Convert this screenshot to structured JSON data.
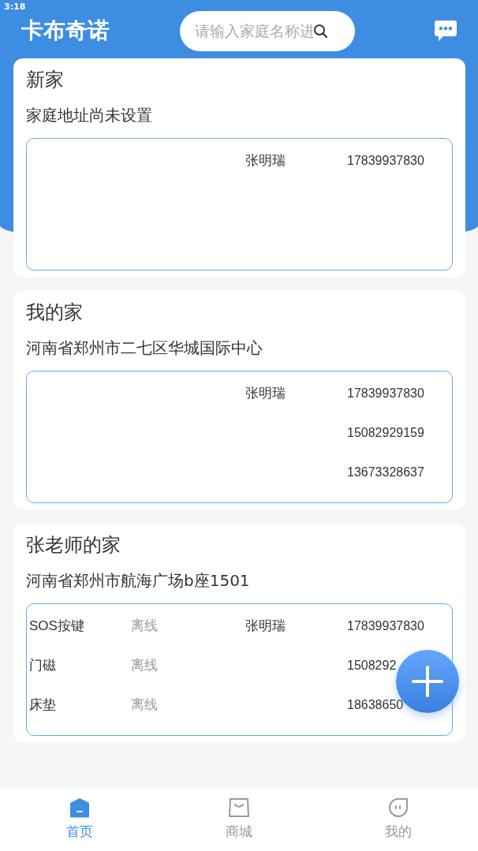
{
  "status_bar": {
    "time": "3:18"
  },
  "header": {
    "title": "卡布奇诺",
    "search": {
      "placeholder": "请输入家庭名称进"
    }
  },
  "homes": [
    {
      "name": "新家",
      "address": "家庭地址尚未设置",
      "rows": [
        {
          "contact": "张明瑞",
          "phone": "17839937830"
        }
      ]
    },
    {
      "name": "我的家",
      "address": "河南省郑州市二七区华城国际中心",
      "rows": [
        {
          "contact": "张明瑞",
          "phone": "17839937830"
        },
        {
          "phone": "15082929159"
        },
        {
          "phone": "13673328637"
        }
      ]
    },
    {
      "name": "张老师的家",
      "address": "河南省郑州市航海广场b座1501",
      "rows": [
        {
          "device": "SOS按键",
          "status": "离线",
          "contact": "张明瑞",
          "phone": "17839937830"
        },
        {
          "device": "门磁",
          "status": "离线",
          "phone": "1508292"
        },
        {
          "device": "床垫",
          "status": "离线",
          "phone": "18638650"
        }
      ]
    }
  ],
  "tabs": [
    {
      "label": "首页",
      "kind": "home",
      "selected": true
    },
    {
      "label": "商城",
      "kind": "shop",
      "selected": false
    },
    {
      "label": "我的",
      "kind": "me",
      "selected": false
    }
  ]
}
